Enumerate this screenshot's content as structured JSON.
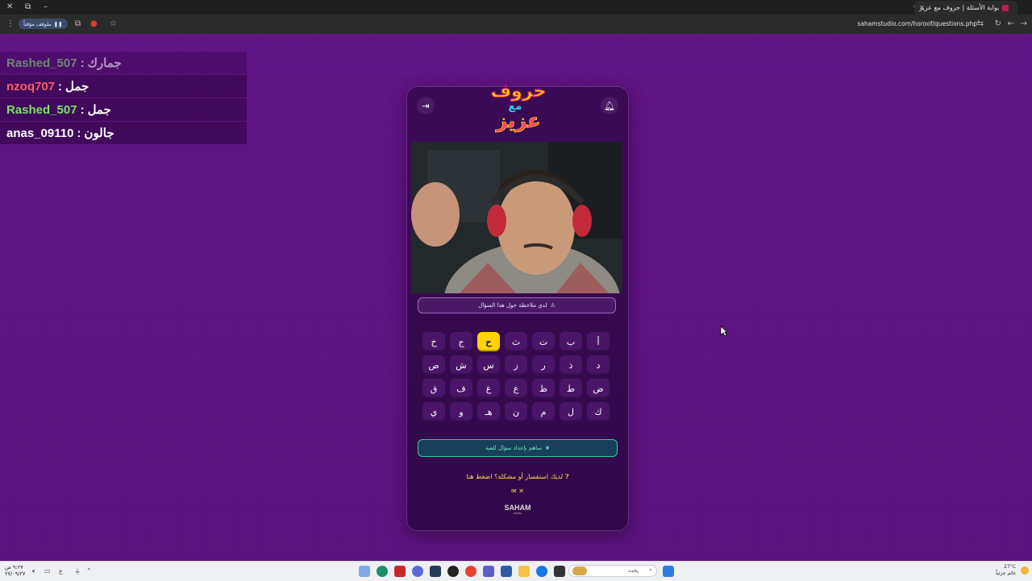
{
  "browser": {
    "tab_title": "بوابة الأسئلة | حروف مع عزيز",
    "url": "sahamstudio.com/horoof/questions.php",
    "pill_label": "ملوقف مؤقتاً"
  },
  "chat": [
    {
      "user": "Rashed_507",
      "message": "جمارك",
      "user_color": "#7ee06b",
      "faded": true
    },
    {
      "user": "nzoq707",
      "message": "جمل",
      "user_color": "#ff5a6e",
      "faded": false
    },
    {
      "user": "Rashed_507",
      "message": "جمل",
      "user_color": "#7ee06b",
      "faded": false
    },
    {
      "user": "anas_09110",
      "message": "جالون",
      "user_color": "#ffffff",
      "faded": false
    }
  ],
  "card": {
    "logo_lines": [
      "حروف",
      "مع",
      "عزيز"
    ],
    "note_button": "لدي ملاحظة حول هذا السؤال",
    "letters": [
      "أ",
      "ب",
      "ت",
      "ث",
      "ح",
      "ج",
      "خ",
      "د",
      "ذ",
      "ر",
      "ز",
      "س",
      "ش",
      "ص",
      "ض",
      "ط",
      "ظ",
      "ع",
      "غ",
      "ف",
      "ق",
      "ك",
      "ل",
      "م",
      "ن",
      "هـ",
      "و",
      "ي"
    ],
    "active_letter": "ح",
    "contribute_button": "ساهم بإعداد سؤال للعبة",
    "help_text": "لديك استفسار أو مشكلة؟ اضغط هنا",
    "brand": "SAHAM",
    "brand_sub": "studio"
  },
  "taskbar": {
    "time": "٩:٢٧ ص",
    "date": "٢٧/٠٩/٢٧",
    "language": "ع",
    "search_placeholder": "بحث",
    "temperature": "27°C",
    "weather": "غائم جزئياً"
  },
  "colors": {
    "background": "#5b157f",
    "card": "#3b0a55",
    "active_key": "#ffd400",
    "accent_green": "#2fd0a0"
  }
}
